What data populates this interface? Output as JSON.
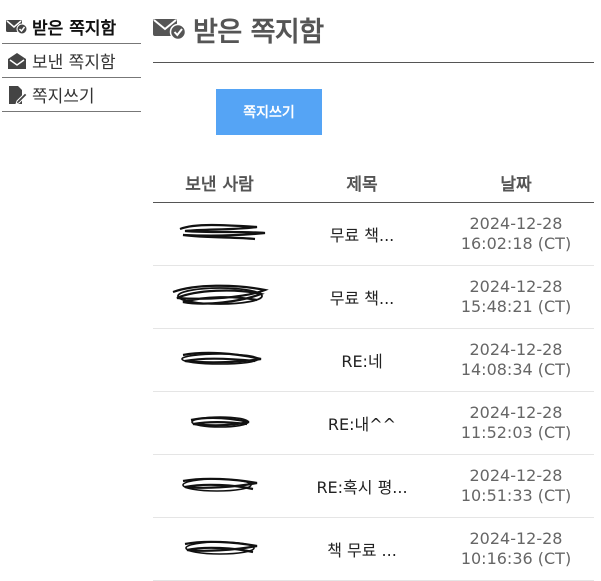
{
  "sidebar": {
    "items": [
      {
        "label": "받은 쪽지함",
        "icon": "envelope-check-icon",
        "active": true
      },
      {
        "label": "보낸 쪽지함",
        "icon": "open-envelope-icon",
        "active": false
      },
      {
        "label": "쪽지쓰기",
        "icon": "pen-document-icon",
        "active": false
      }
    ]
  },
  "header": {
    "title": "받은 쪽지함",
    "icon": "envelope-check-icon"
  },
  "compose_button": "쪽지쓰기",
  "table": {
    "columns": [
      "보낸 사람",
      "제목",
      "날짜"
    ],
    "rows": [
      {
        "sender": "",
        "subject": "무료 책...",
        "date": "2024-12-28",
        "time": "16:02:18 (CT)"
      },
      {
        "sender": "",
        "subject": "무료 책...",
        "date": "2024-12-28",
        "time": "15:48:21 (CT)"
      },
      {
        "sender": "",
        "subject": "RE:네",
        "date": "2024-12-28",
        "time": "14:08:34 (CT)"
      },
      {
        "sender": "",
        "subject": "RE:내^^",
        "date": "2024-12-28",
        "time": "11:52:03 (CT)"
      },
      {
        "sender": "",
        "subject": "RE:혹시 평...",
        "date": "2024-12-28",
        "time": "10:51:33 (CT)"
      },
      {
        "sender": "",
        "subject": "책 무료 ...",
        "date": "2024-12-28",
        "time": "10:16:36 (CT)"
      }
    ]
  },
  "colors": {
    "accent": "#55a4f5",
    "title": "#555555",
    "rule": "#555555"
  }
}
